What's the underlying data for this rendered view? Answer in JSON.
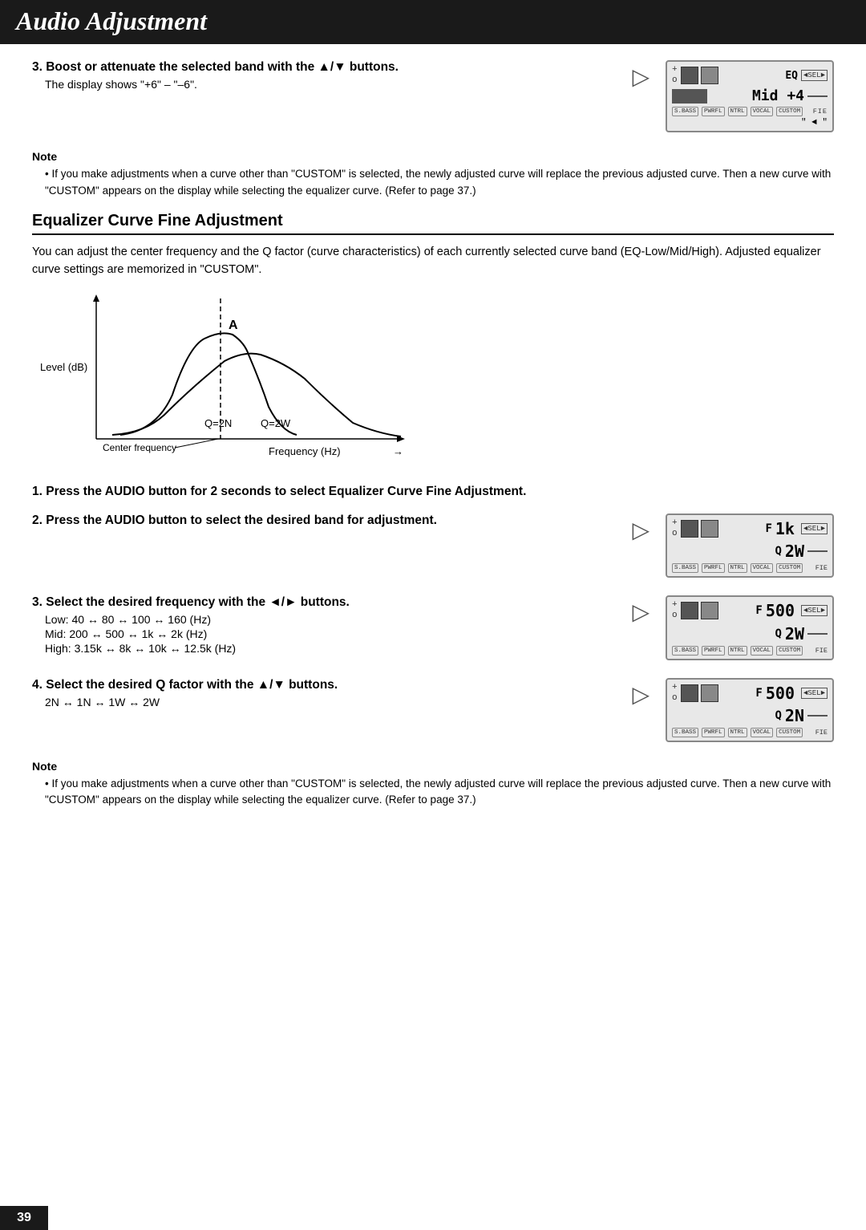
{
  "header": {
    "title": "Audio Adjustment"
  },
  "page_number": "39",
  "section1": {
    "step3_heading": "3.  Boost or attenuate the selected band with the ▲/▼ buttons.",
    "step3_sub": "The display shows \"+6\" – \"–6\".",
    "note_title": "Note",
    "note_text": "If you make adjustments when a curve other than \"CUSTOM\" is selected, the newly adjusted curve will replace the previous adjusted curve. Then a new curve with \"CUSTOM\" appears on the display while selecting the equalizer curve. (Refer to page 37.)"
  },
  "eq_curve_section": {
    "heading": "Equalizer Curve Fine Adjustment",
    "body": "You can adjust the center frequency and the Q factor (curve characteristics) of each currently selected curve band (EQ-Low/Mid/High). Adjusted equalizer curve settings are memorized in \"CUSTOM\".",
    "graph": {
      "y_label": "Level (dB)",
      "x_label": "Frequency (Hz)",
      "center_freq_label": "Center frequency",
      "q2n_label": "Q=2N",
      "q2w_label": "Q=2W",
      "arrow_up": "↑",
      "arrow_right": "→"
    }
  },
  "section2": {
    "step1_heading": "1.  Press the AUDIO button for 2 seconds to select Equalizer Curve Fine Adjustment.",
    "step2_heading": "2.  Press the AUDIO button to select the desired band for adjustment.",
    "step3_heading": "3.  Select the desired frequency with the ◄/► buttons.",
    "step3_sub_low": "Low:   40 ↔ 80 ↔ 100 ↔ 160 (Hz)",
    "step3_sub_mid": "Mid:   200 ↔ 500 ↔ 1k ↔ 2k (Hz)",
    "step3_sub_high": "High:  3.15k ↔ 8k ↔ 10k ↔ 12.5k (Hz)",
    "step4_heading": "4.  Select the desired Q factor with the ▲/▼ buttons.",
    "step4_sub": "2N ↔ 1N ↔ 1W ↔ 2W",
    "note_title": "Note",
    "note_text": "If you make adjustments when a curve other than \"CUSTOM\" is selected, the newly adjusted curve will replace the previous adjusted curve. Then a new curve with \"CUSTOM\" appears on the display while selecting the equalizer curve. (Refer to page 37.)"
  },
  "display1": {
    "top_label": "EQ",
    "value": "Mid +4",
    "sel": "◄SEL►",
    "tags": [
      "S.BASS",
      "PWRFL",
      "NTRL",
      "VOCAL",
      "CUSTOM"
    ],
    "fie": "FIE"
  },
  "display2": {
    "f_label": "F",
    "f_value": "1k",
    "q_label": "Q",
    "q_value": "2W",
    "sel": "◄SEL►",
    "tags": [
      "S.BASS",
      "PWRFL",
      "NTRL",
      "VOCAL",
      "CUSTOM"
    ],
    "fie": "FIE"
  },
  "display3": {
    "f_label": "F",
    "f_value": "500",
    "q_label": "Q",
    "q_value": "2W",
    "sel": "◄SEL►",
    "tags": [
      "S.BASS",
      "PWRFL",
      "NTRL",
      "VOCAL",
      "CUSTOM"
    ],
    "fie": "FIE"
  },
  "display4": {
    "f_label": "F",
    "f_value": "500",
    "q_label": "Q",
    "q_value": "2N",
    "sel": "◄SEL►",
    "tags": [
      "S.BASS",
      "PWRFL",
      "NTRL",
      "VOCAL",
      "CUSTOM"
    ],
    "fie": "FIE"
  }
}
